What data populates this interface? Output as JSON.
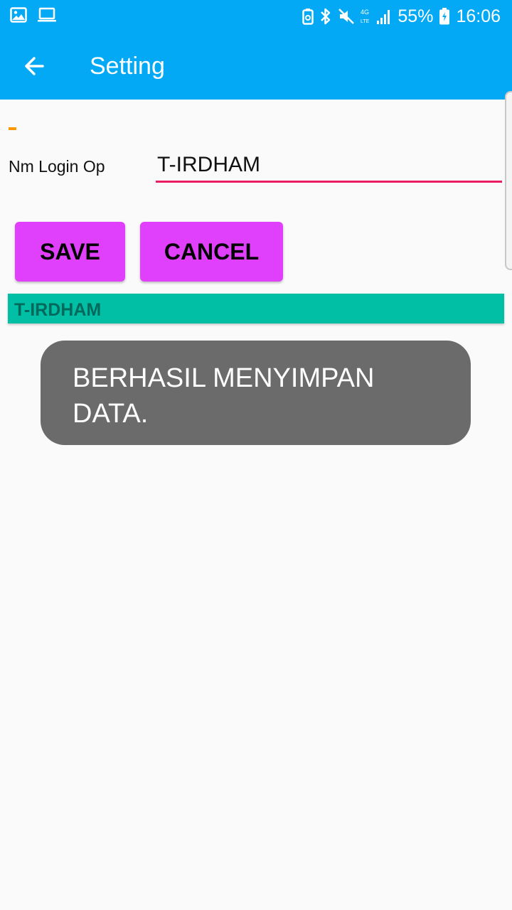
{
  "status_bar": {
    "battery_percent": "55%",
    "time": "16:06",
    "icons": [
      "gallery-icon",
      "laptop-icon",
      "battery-saver-icon",
      "bluetooth-icon",
      "mute-icon",
      "4g-lte-icon",
      "signal-icon",
      "battery-icon"
    ]
  },
  "app_bar": {
    "title": "Setting",
    "back_icon": "back-arrow-icon",
    "color": "#03a9f4"
  },
  "form": {
    "login_label": "Nm Login Op",
    "login_value": "T-IRDHAM",
    "underline_color": "#e91e63",
    "indicator_color": "#ff9800"
  },
  "buttons": {
    "save_label": "SAVE",
    "cancel_label": "CANCEL",
    "color": "#e040fb"
  },
  "result": {
    "text": "T-IRDHAM",
    "color": "#00bfa5"
  },
  "toast": {
    "message": "BERHASIL MENYIMPAN DATA."
  }
}
